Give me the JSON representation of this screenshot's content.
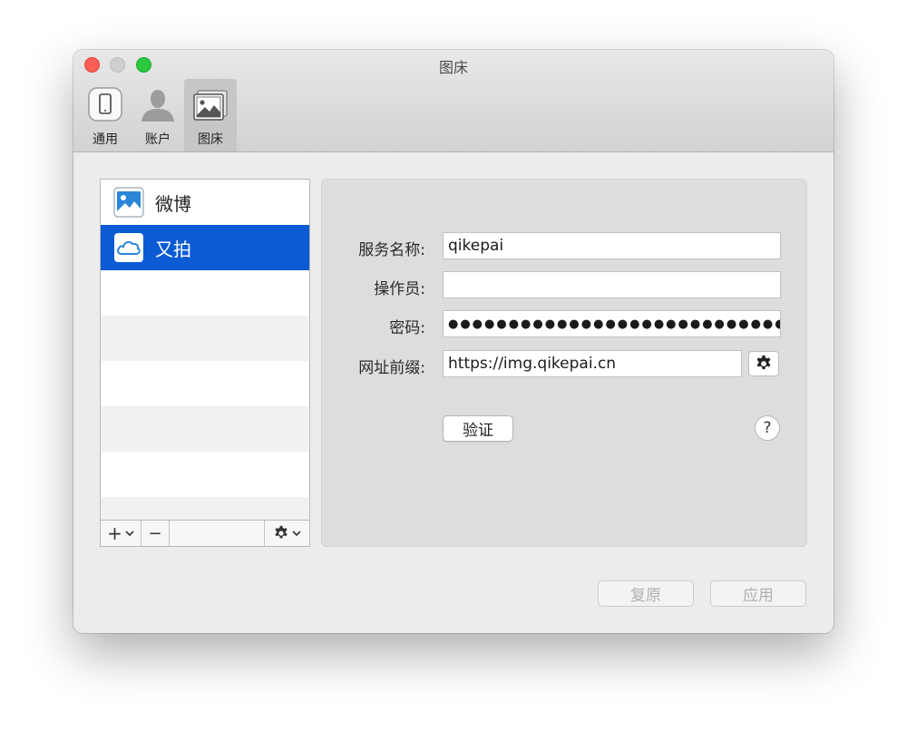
{
  "window": {
    "title": "图床"
  },
  "toolbar": {
    "items": [
      {
        "label": "通用",
        "icon": "phone-icon"
      },
      {
        "label": "账户",
        "icon": "user-icon"
      },
      {
        "label": "图床",
        "icon": "photos-icon",
        "active": true
      }
    ]
  },
  "services": {
    "items": [
      {
        "label": "微博",
        "icon": "image-icon",
        "selected": false
      },
      {
        "label": "又拍",
        "icon": "cloud-icon",
        "selected": true
      }
    ],
    "toolbar": {
      "add": "+",
      "remove": "−"
    }
  },
  "form": {
    "service_name_label": "服务名称:",
    "service_name_value": "qikepai",
    "operator_label": "操作员:",
    "operator_value": "",
    "password_label": "密码:",
    "password_value": "●●●●●●●●●●●●●●●●●●●●●●●●●●●●●●",
    "url_prefix_label": "网址前缀:",
    "url_prefix_value": "https://img.qikepai.cn",
    "verify_button": "验证",
    "help_button": "?"
  },
  "footer": {
    "revert_button": "复原",
    "apply_button": "应用"
  },
  "colors": {
    "selection": "#0b5bd4",
    "close": "#fd5f57",
    "zoom": "#2bc840"
  }
}
